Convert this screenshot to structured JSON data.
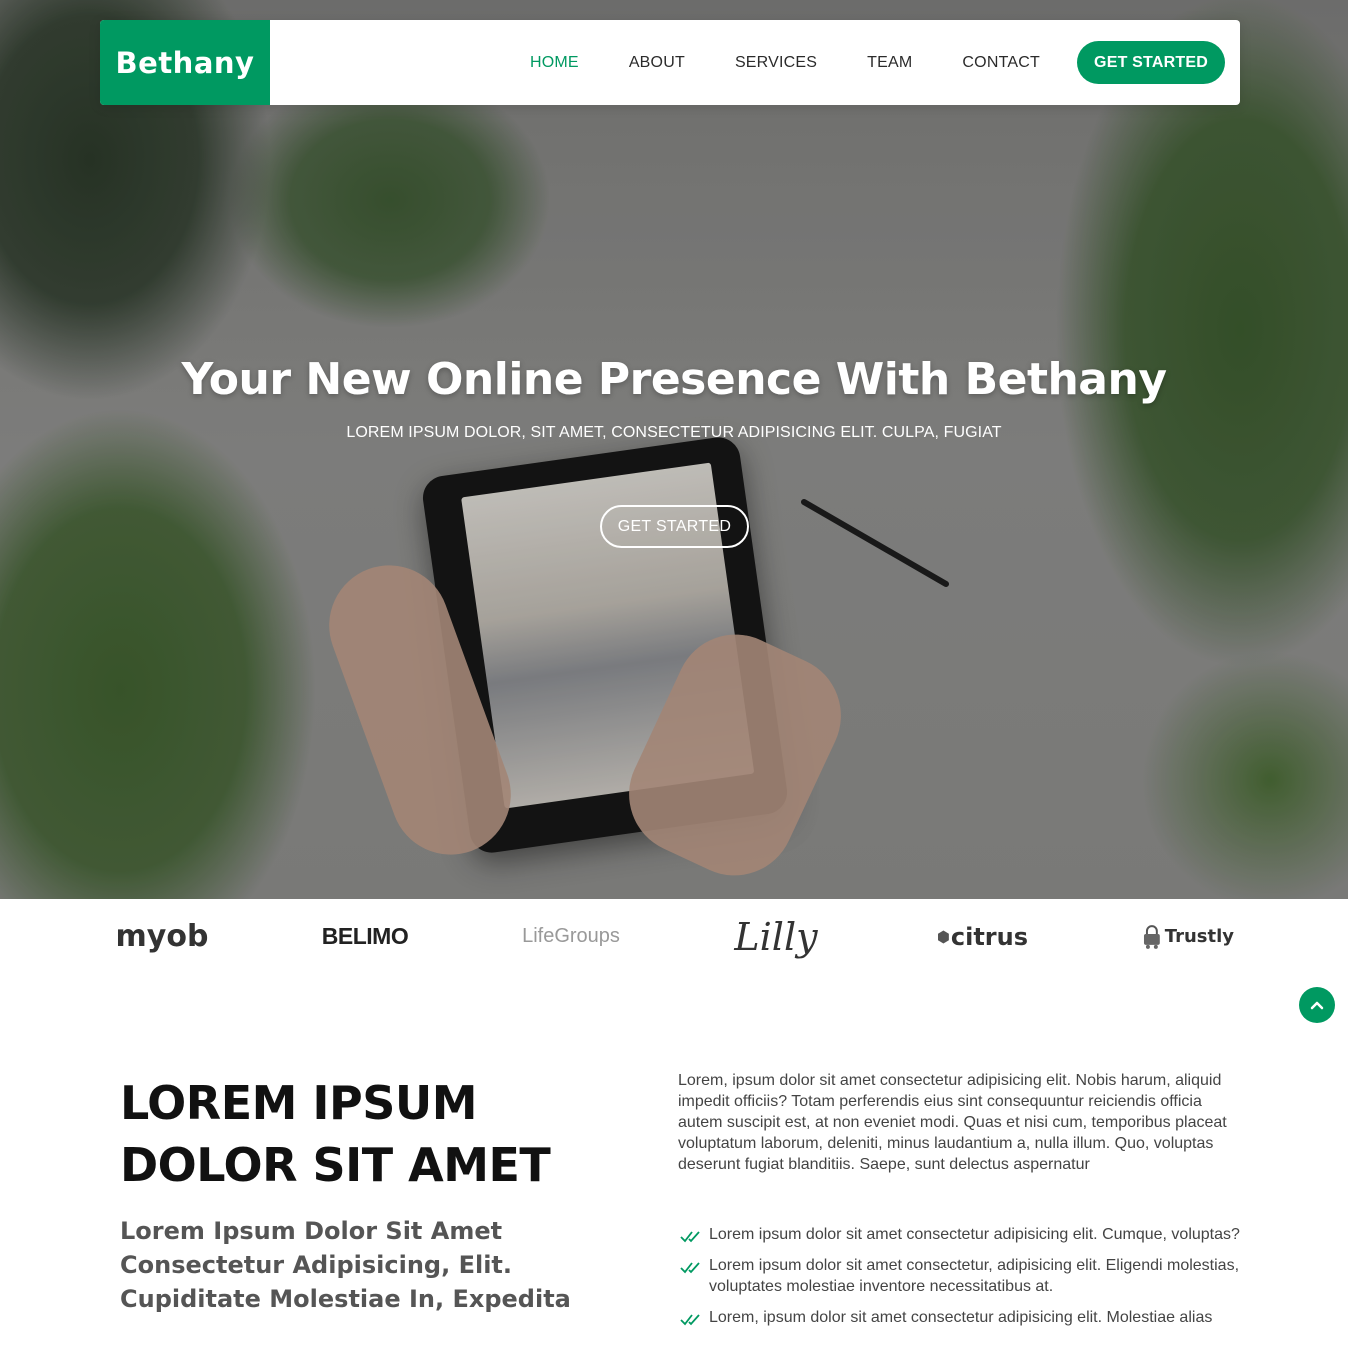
{
  "brand": {
    "name": "Bethany",
    "accent": "#009961"
  },
  "nav": {
    "items": [
      {
        "label": "HOME",
        "active": true
      },
      {
        "label": "ABOUT",
        "active": false
      },
      {
        "label": "SERVICES",
        "active": false
      },
      {
        "label": "TEAM",
        "active": false
      },
      {
        "label": "CONTACT",
        "active": false
      }
    ],
    "cta": "GET STARTED"
  },
  "hero": {
    "title": "Your New Online Presence With Bethany",
    "subtitle": "LOREM IPSUM DOLOR, SIT AMET, CONSECTETUR ADIPISICING ELIT. CULPA, FUGIAT",
    "button": "GET STARTED"
  },
  "clients": {
    "logos": [
      {
        "name": "myob"
      },
      {
        "name": "BELIMO"
      },
      {
        "name": "LifeGroups"
      },
      {
        "name": "Lilly"
      },
      {
        "name": "citrus"
      },
      {
        "name": "Trustly"
      }
    ]
  },
  "back_to_top": {
    "icon": "chevron-up-icon"
  },
  "about": {
    "title": "LOREM IPSUM DOLOR SIT AMET",
    "subtitle": "Lorem Ipsum Dolor Sit Amet Consectetur Adipisicing, Elit. Cupiditate Molestiae In, Expedita",
    "paragraph": "Lorem, ipsum dolor sit amet consectetur adipisicing elit. Nobis harum, aliquid impedit officiis? Totam perferendis eius sint consequuntur reiciendis officia autem suscipit est, at non eveniet modi. Quas et nisi cum, temporibus placeat voluptatum laborum, deleniti, minus laudantium a, nulla illum. Quo, voluptas deserunt fugiat blanditiis. Saepe, sunt delectus aspernatur",
    "list": [
      "Lorem ipsum dolor sit amet consectetur adipisicing elit. Cumque, voluptas?",
      "Lorem ipsum dolor sit amet consectetur, adipisicing elit. Eligendi molestias, voluptates molestiae inventore necessitatibus at.",
      "Lorem, ipsum dolor sit amet consectetur adipisicing elit. Molestiae alias"
    ]
  }
}
